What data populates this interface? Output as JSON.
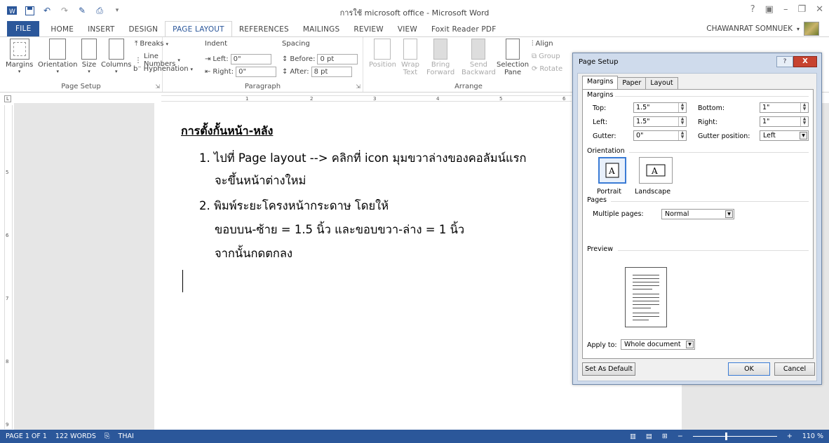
{
  "window": {
    "title": "การใช้ microsoft office - Microsoft Word",
    "controls": [
      "?",
      "□",
      "—",
      "□",
      "✕"
    ]
  },
  "ribbon_tabs": [
    "FILE",
    "HOME",
    "INSERT",
    "DESIGN",
    "PAGE LAYOUT",
    "REFERENCES",
    "MAILINGS",
    "REVIEW",
    "VIEW",
    "Foxit Reader PDF"
  ],
  "active_tab": "PAGE LAYOUT",
  "user_name": "CHAWANRAT SOMNUEK",
  "page_setup_group": {
    "label": "Page Setup",
    "margins": "Margins",
    "orientation": "Orientation",
    "size": "Size",
    "columns": "Columns",
    "breaks": "Breaks",
    "line_numbers": "Line Numbers",
    "hyphenation": "Hyphenation"
  },
  "paragraph_group": {
    "label": "Paragraph",
    "indent": "Indent",
    "spacing": "Spacing",
    "left_label": "Left:",
    "left_value": "0\"",
    "right_label": "Right:",
    "right_value": "0\"",
    "before_label": "Before:",
    "before_value": "0 pt",
    "after_label": "After:",
    "after_value": "8 pt"
  },
  "arrange_group": {
    "label": "Arrange",
    "position": "Position",
    "wrap_text_1": "Wrap",
    "wrap_text_2": "Text",
    "bring_forward_1": "Bring",
    "bring_forward_2": "Forward",
    "send_backward_1": "Send",
    "send_backward_2": "Backward",
    "selection_pane_1": "Selection",
    "selection_pane_2": "Pane",
    "align": "Align",
    "group": "Group",
    "rotate": "Rotate"
  },
  "document": {
    "heading": "การตั้งกั้นหน้า-หลัง",
    "line1": "1. ไปที่ Page layout --> คลิกที่ icon มุมขวาล่างของคอลัมน์แรก",
    "line2": "จะขึ้นหน้าต่างใหม่",
    "line3": "2. พิมพ์ระยะโครงหน้ากระดาษ โดยให้",
    "line4": "ขอบบน-ซ้าย = 1.5 นิ้ว และขอบขวา-ล่าง = 1 นิ้ว",
    "line5": "จากนั้นกดตกลง"
  },
  "ruler_numbers": [
    "1",
    "2",
    "3",
    "4",
    "5",
    "6"
  ],
  "vruler_numbers": [
    "5",
    "6",
    "7",
    "8",
    "9"
  ],
  "status": {
    "page": "PAGE 1 OF 1",
    "words": "122 WORDS",
    "language": "THAI",
    "zoom": "110 %"
  },
  "dialog": {
    "title": "Page Setup",
    "help": "?",
    "close": "X",
    "tabs": [
      "Margins",
      "Paper",
      "Layout"
    ],
    "margins_section": "Margins",
    "top_label": "Top:",
    "top_value": "1.5\"",
    "bottom_label": "Bottom:",
    "bottom_value": "1\"",
    "left_label": "Left:",
    "left_value": "1.5\"",
    "right_label": "Right:",
    "right_value": "1\"",
    "gutter_label": "Gutter:",
    "gutter_value": "0\"",
    "gutter_pos_label": "Gutter position:",
    "gutter_pos_value": "Left",
    "orientation_section": "Orientation",
    "portrait": "Portrait",
    "landscape": "Landscape",
    "pages_section": "Pages",
    "multiple_pages_label": "Multiple pages:",
    "multiple_pages_value": "Normal",
    "preview_section": "Preview",
    "apply_to_label": "Apply to:",
    "apply_to_value": "Whole document",
    "set_default": "Set As Default",
    "ok": "OK",
    "cancel": "Cancel"
  }
}
